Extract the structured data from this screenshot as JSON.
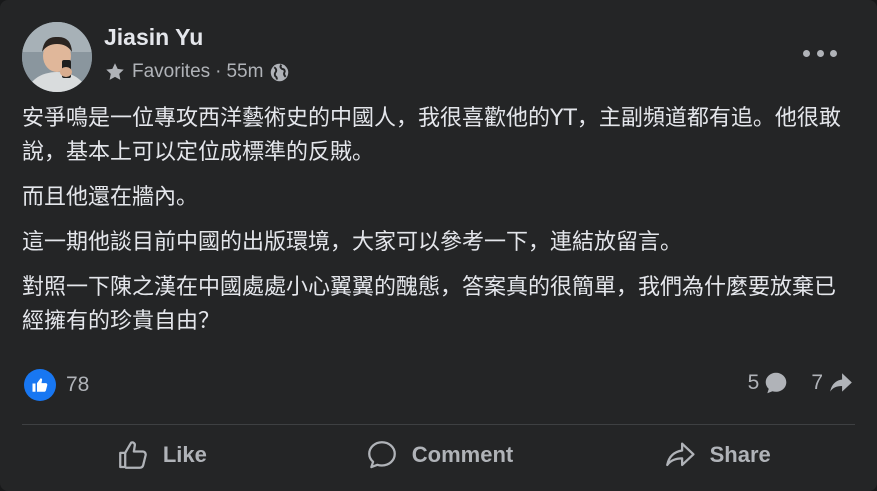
{
  "post": {
    "author": "Jiasin Yu",
    "audience": "Favorites",
    "separator": "·",
    "time": "55m",
    "avatar_icon": "user-avatar-photo",
    "paragraphs": [
      "安爭鳴是一位專攻西洋藝術史的中國人，我很喜歡他的YT，主副頻道都有追。他很敢說，基本上可以定位成標準的反賊。",
      "而且他還在牆內。",
      "這一期他談目前中國的出版環境，大家可以參考一下，連結放留言。",
      "對照一下陳之漢在中國處處小心翼翼的醜態，答案真的很簡單，我們為什麼要放棄已經擁有的珍貴自由？"
    ],
    "reactions_count": "78",
    "comments_count": "5",
    "shares_count": "7"
  },
  "actions": {
    "like_label": "Like",
    "comment_label": "Comment",
    "share_label": "Share"
  },
  "colors": {
    "background": "#242526",
    "text_primary": "#e4e6eb",
    "text_secondary": "#b0b3b8",
    "like_blue": "#1877f2",
    "divider": "#3e4042"
  }
}
